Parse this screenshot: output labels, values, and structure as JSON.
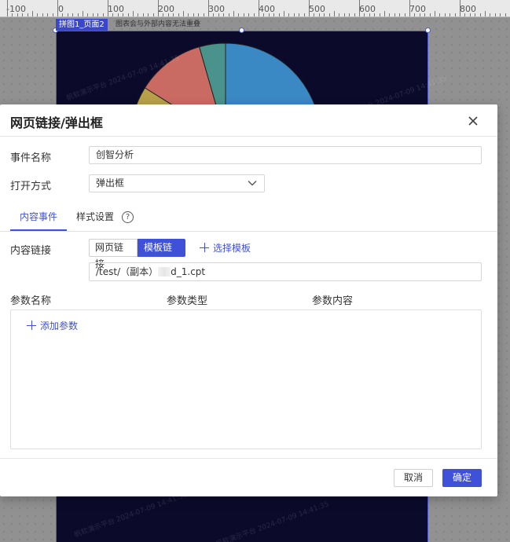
{
  "ruler": {
    "labels": [
      "-100",
      "0",
      "100",
      "200",
      "300",
      "400",
      "500",
      "600",
      "700",
      "800"
    ]
  },
  "widget": {
    "tag": "拼图1_页面2",
    "hint": "图表会与外部内容无法重叠",
    "pie_colors": [
      "#3a88c4",
      "#c96b62",
      "#b8a04a",
      "#4a938c"
    ],
    "watermark": "帆软演示平台 2024-07-09 14:41:35"
  },
  "dialog": {
    "title": "网页链接/弹出框",
    "event_name_label": "事件名称",
    "event_name_value": "创智分析",
    "open_mode_label": "打开方式",
    "open_mode_value": "弹出框",
    "tabs": {
      "content": "内容事件",
      "style": "样式设置",
      "help": "?"
    },
    "content_link_label": "内容链接",
    "link_type": {
      "web": "网页链接",
      "template": "模板链接"
    },
    "choose_template": "选择模板",
    "template_path_prefix": "/test/（副本）",
    "template_path_suffix": "d_1.cpt",
    "params": {
      "name_header": "参数名称",
      "type_header": "参数类型",
      "value_header": "参数内容",
      "add_label": "添加参数"
    },
    "buttons": {
      "cancel": "取消",
      "ok": "确定"
    },
    "accent_color": "#3f51d9"
  }
}
